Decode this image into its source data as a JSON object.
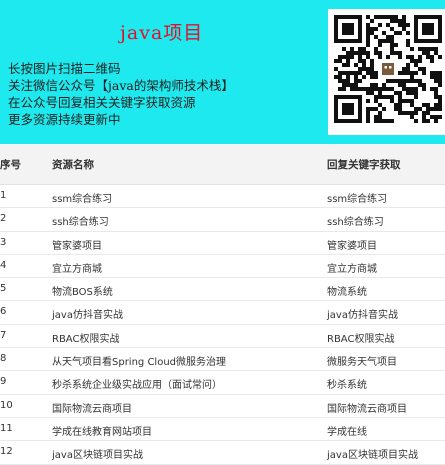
{
  "banner": {
    "title": "java项目",
    "lines": [
      "长按图片扫描二维码",
      "关注微信公众号【java的架构师技术栈】",
      "在公众号回复相关关键字获取资源",
      "更多资源持续更新中"
    ],
    "bg_color": "#1de9ee",
    "title_color": "#e0102a",
    "qr_icon": "qr-code-icon"
  },
  "table": {
    "headers": [
      "序号",
      "资源名称",
      "回复关键字获取"
    ],
    "rows": [
      {
        "num": "1",
        "name": "ssm综合练习",
        "keyword": "ssm综合练习"
      },
      {
        "num": "2",
        "name": "ssh综合练习",
        "keyword": "ssh综合练习"
      },
      {
        "num": "3",
        "name": "管家婆项目",
        "keyword": "管家婆项目"
      },
      {
        "num": "4",
        "name": "宜立方商城",
        "keyword": "宜立方商城"
      },
      {
        "num": "5",
        "name": "物流BOS系统",
        "keyword": "物流系统"
      },
      {
        "num": "6",
        "name": "java仿抖音实战",
        "keyword": "java仿抖音实战"
      },
      {
        "num": "7",
        "name": "RBAC权限实战",
        "keyword": "RBAC权限实战"
      },
      {
        "num": "8",
        "name": "从天气项目看Spring Cloud微服务治理",
        "keyword": "微服务天气项目"
      },
      {
        "num": "9",
        "name": "秒杀系统企业级实战应用（面试常问）",
        "keyword": "秒杀系统"
      },
      {
        "num": "10",
        "name": "国际物流云商项目",
        "keyword": "国际物流云商项目"
      },
      {
        "num": "11",
        "name": "学成在线教育网站项目",
        "keyword": "学成在线"
      },
      {
        "num": "12",
        "name": "java区块链项目实战",
        "keyword": "java区块链项目实战"
      }
    ]
  }
}
